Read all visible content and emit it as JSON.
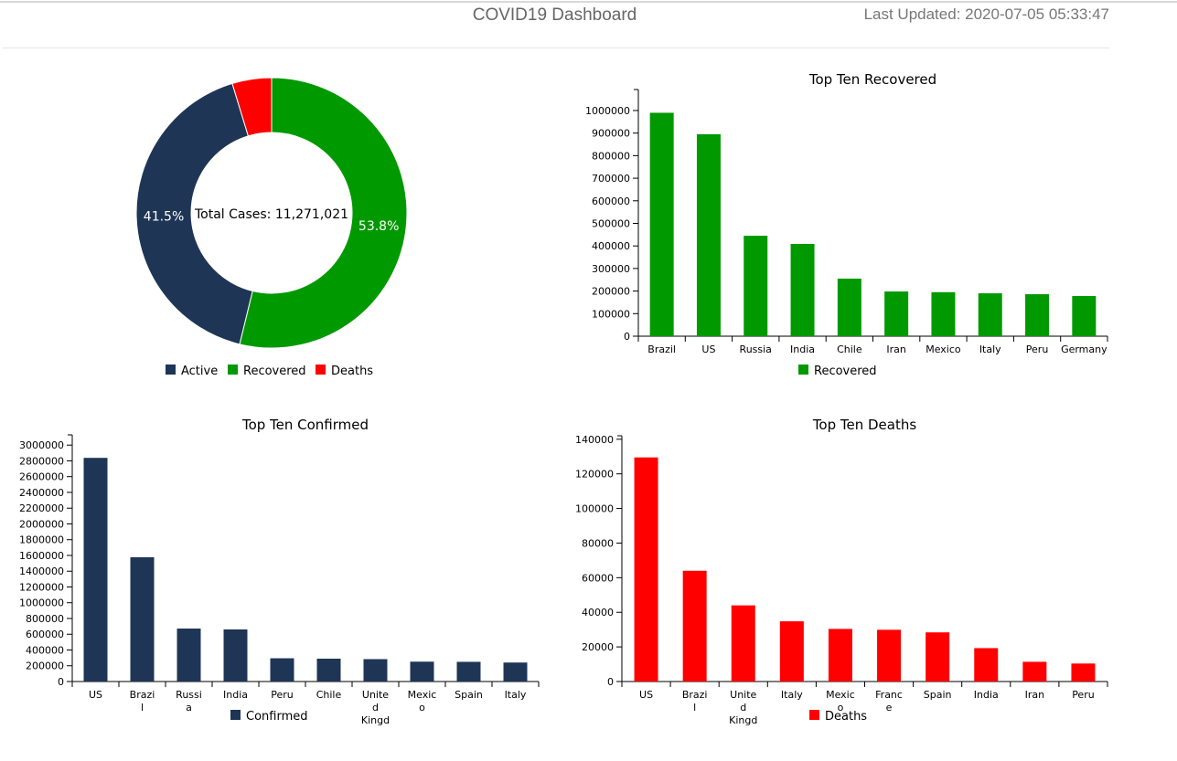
{
  "header": {
    "title": "COVID19 Dashboard",
    "last_updated": "Last Updated: 2020-07-05 05:33:47"
  },
  "chart_data": [
    {
      "type": "pie",
      "variant": "donut",
      "center_label": "Total Cases: 11,271,021",
      "slices": [
        {
          "name": "Recovered",
          "percent": 53.8,
          "label": "53.8%",
          "color": "#009900"
        },
        {
          "name": "Active",
          "percent": 41.5,
          "label": "41.5%",
          "color": "#1f3556"
        },
        {
          "name": "Deaths",
          "percent": 4.7,
          "label": "",
          "color": "#ff0000"
        }
      ],
      "legend": [
        "Active",
        "Recovered",
        "Deaths"
      ],
      "legend_placement": "bottom"
    },
    {
      "type": "bar",
      "title": "Top Ten Recovered",
      "color": "#009900",
      "categories": [
        "Brazil",
        "US",
        "Russia",
        "India",
        "Chile",
        "Iran",
        "Mexico",
        "Italy",
        "Peru",
        "Germany"
      ],
      "tick_labels": [
        [
          "Brazil"
        ],
        [
          "US"
        ],
        [
          "Russia"
        ],
        [
          "India"
        ],
        [
          "Chile"
        ],
        [
          "Iran"
        ],
        [
          "Mexico"
        ],
        [
          "Italy"
        ],
        [
          "Peru"
        ],
        [
          "Germany"
        ]
      ],
      "series": [
        {
          "name": "Recovered",
          "values": [
            990000,
            895000,
            445000,
            409000,
            255000,
            198000,
            195000,
            190000,
            186000,
            178000
          ]
        }
      ],
      "ylim": [
        0,
        1093000
      ],
      "yticks": [
        0,
        100000,
        200000,
        300000,
        400000,
        500000,
        600000,
        700000,
        800000,
        900000,
        1000000
      ],
      "legend_placement": "bottom"
    },
    {
      "type": "bar",
      "title": "Top Ten Confirmed",
      "color": "#1f3556",
      "categories": [
        "US",
        "Brazil",
        "Russia",
        "India",
        "Peru",
        "Chile",
        "United Kingd",
        "Mexico",
        "Spain",
        "Italy"
      ],
      "tick_labels": [
        [
          "US"
        ],
        [
          "Brazi",
          "l"
        ],
        [
          "Russi",
          "a"
        ],
        [
          "India"
        ],
        [
          "Peru"
        ],
        [
          "Chile"
        ],
        [
          "Unite",
          "d",
          "Kingd"
        ],
        [
          "Mexic",
          "o"
        ],
        [
          "Spain"
        ],
        [
          "Italy"
        ]
      ],
      "series": [
        {
          "name": "Confirmed",
          "values": [
            2838000,
            1577000,
            672000,
            661000,
            295000,
            290000,
            284000,
            252000,
            250000,
            241000
          ]
        }
      ],
      "ylim": [
        0,
        3130000
      ],
      "yticks": [
        0,
        200000,
        400000,
        600000,
        800000,
        1000000,
        1200000,
        1400000,
        1600000,
        1800000,
        2000000,
        2200000,
        2400000,
        2600000,
        2800000,
        3000000
      ],
      "legend_placement": "bottom"
    },
    {
      "type": "bar",
      "title": "Top Ten Deaths",
      "color": "#ff0000",
      "categories": [
        "US",
        "Brazil",
        "United Kingd",
        "Italy",
        "Mexico",
        "France",
        "Spain",
        "India",
        "Iran",
        "Peru"
      ],
      "tick_labels": [
        [
          "US"
        ],
        [
          "Brazi",
          "l"
        ],
        [
          "Unite",
          "d",
          "Kingd"
        ],
        [
          "Italy"
        ],
        [
          "Mexic",
          "o"
        ],
        [
          "Franc",
          "e"
        ],
        [
          "Spain"
        ],
        [
          "India"
        ],
        [
          "Iran"
        ],
        [
          "Peru"
        ]
      ],
      "series": [
        {
          "name": "Deaths",
          "values": [
            129500,
            64000,
            44000,
            34800,
            30400,
            29900,
            28400,
            19300,
            11400,
            10400
          ]
        }
      ],
      "ylim": [
        0,
        142000
      ],
      "yticks": [
        0,
        20000,
        40000,
        60000,
        80000,
        100000,
        120000,
        140000
      ],
      "legend_placement": "bottom"
    }
  ]
}
